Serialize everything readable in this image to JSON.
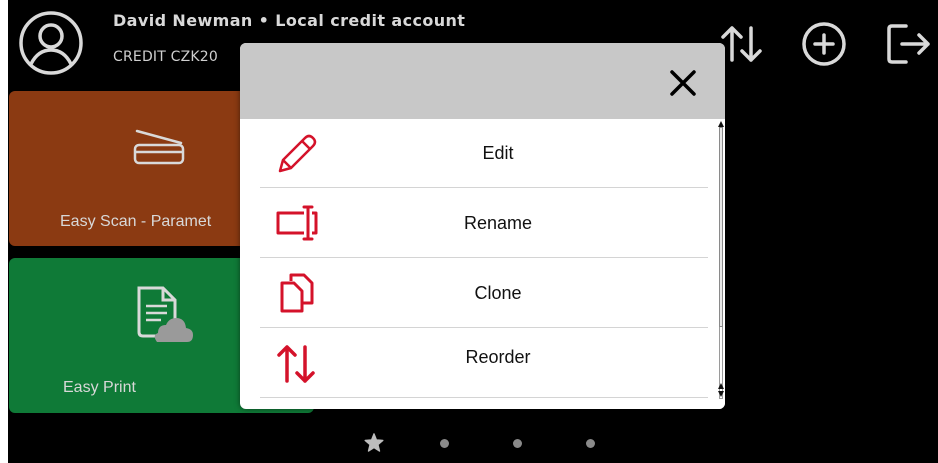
{
  "header": {
    "user_line": "David Newman • Local credit account",
    "credit_line": "CREDIT CZK20"
  },
  "tiles": [
    {
      "label": "Easy Scan - Paramet",
      "color": "#8b3a12",
      "icon": "scanner-icon"
    },
    {
      "label": "Easy Print",
      "color": "#0f7a37",
      "icon": "document-cloud-icon"
    }
  ],
  "dialog": {
    "close_icon": "close-icon",
    "items": [
      {
        "label": "Edit",
        "icon": "pencil-icon"
      },
      {
        "label": "Rename",
        "icon": "rename-icon"
      },
      {
        "label": "Clone",
        "icon": "clone-icon"
      },
      {
        "label": "Reorder",
        "icon": "reorder-icon"
      }
    ],
    "accent": "#d4122a"
  },
  "header_icons": [
    "reorder-arrows-icon",
    "add-icon",
    "logout-icon"
  ],
  "pager": {
    "pages": 4,
    "current": 1,
    "current_icon": "star-icon"
  }
}
